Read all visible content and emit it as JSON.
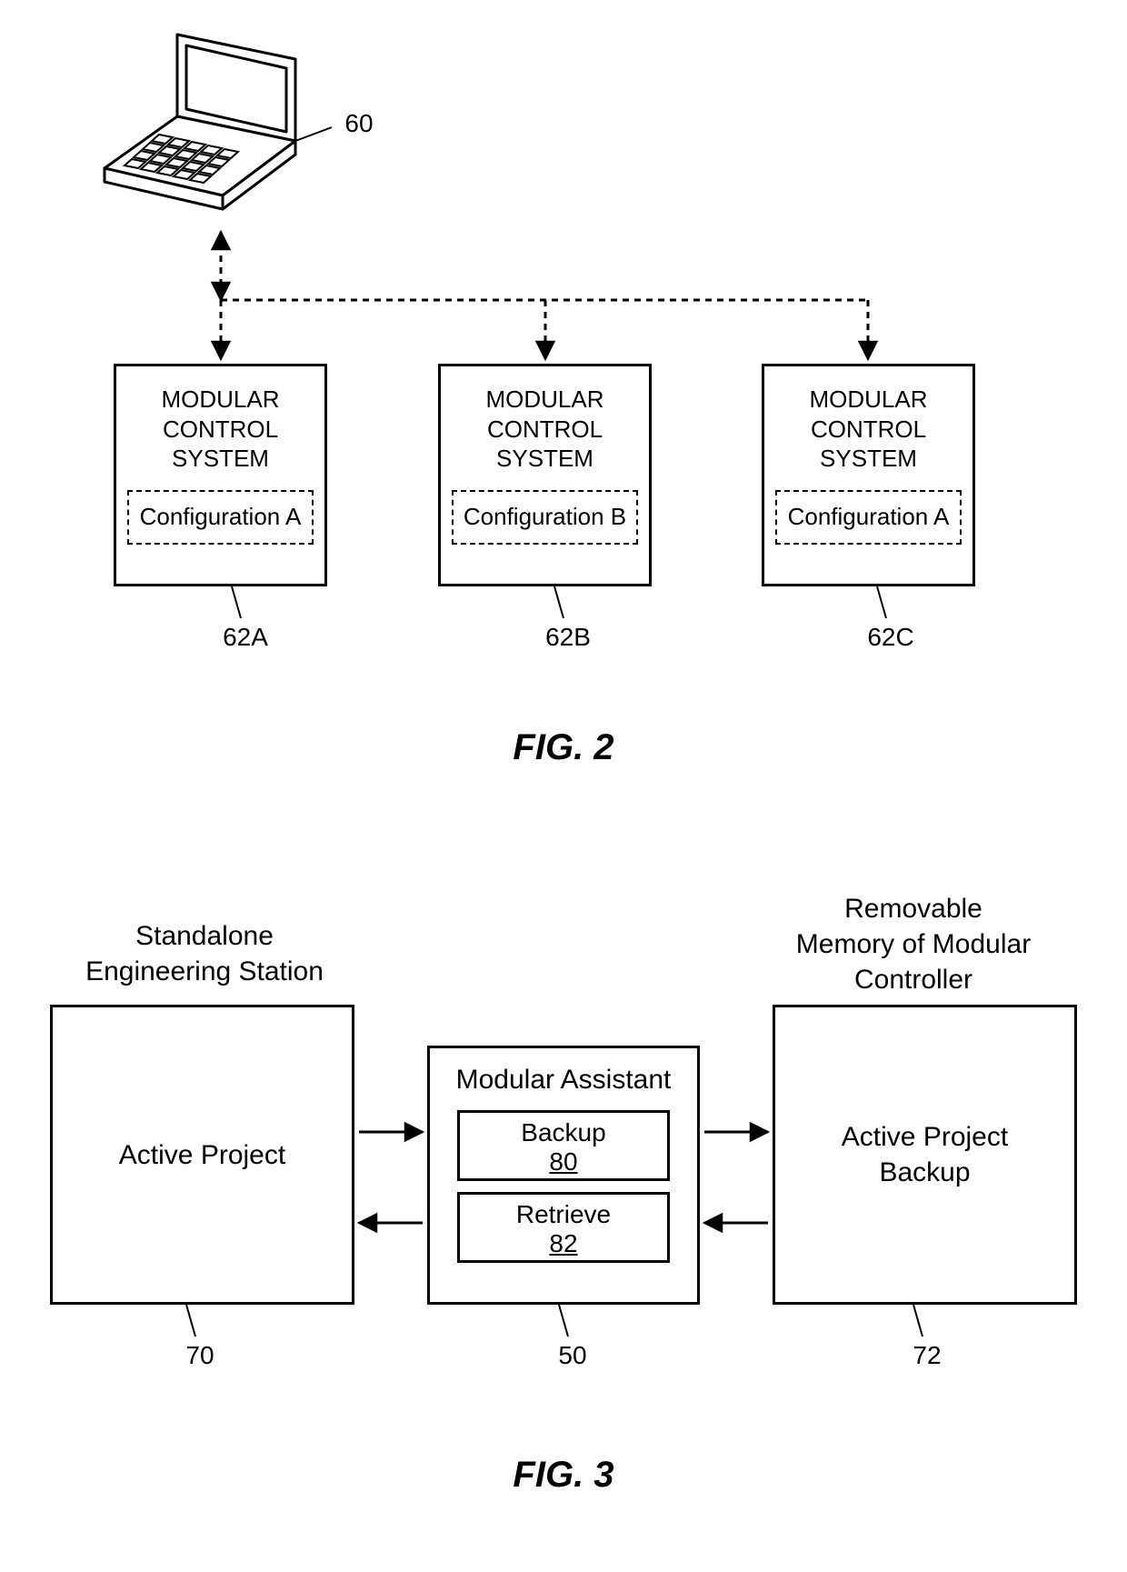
{
  "fig2": {
    "laptop_ref": "60",
    "boxes": [
      {
        "title": "MODULAR\nCONTROL\nSYSTEM",
        "config": "Configuration A",
        "ref": "62A"
      },
      {
        "title": "MODULAR\nCONTROL\nSYSTEM",
        "config": "Configuration B",
        "ref": "62B"
      },
      {
        "title": "MODULAR\nCONTROL\nSYSTEM",
        "config": "Configuration A",
        "ref": "62C"
      }
    ],
    "caption": "FIG. 2"
  },
  "fig3": {
    "left_heading": "Standalone\nEngineering Station",
    "right_heading": "Removable\nMemory of Modular\nController",
    "left_box_text": "Active Project",
    "center_title": "Modular Assistant",
    "backup_label": "Backup",
    "backup_ref": "80",
    "retrieve_label": "Retrieve",
    "retrieve_ref": "82",
    "right_box_text": "Active Project\nBackup",
    "left_ref": "70",
    "center_ref": "50",
    "right_ref": "72",
    "caption": "FIG. 3"
  }
}
